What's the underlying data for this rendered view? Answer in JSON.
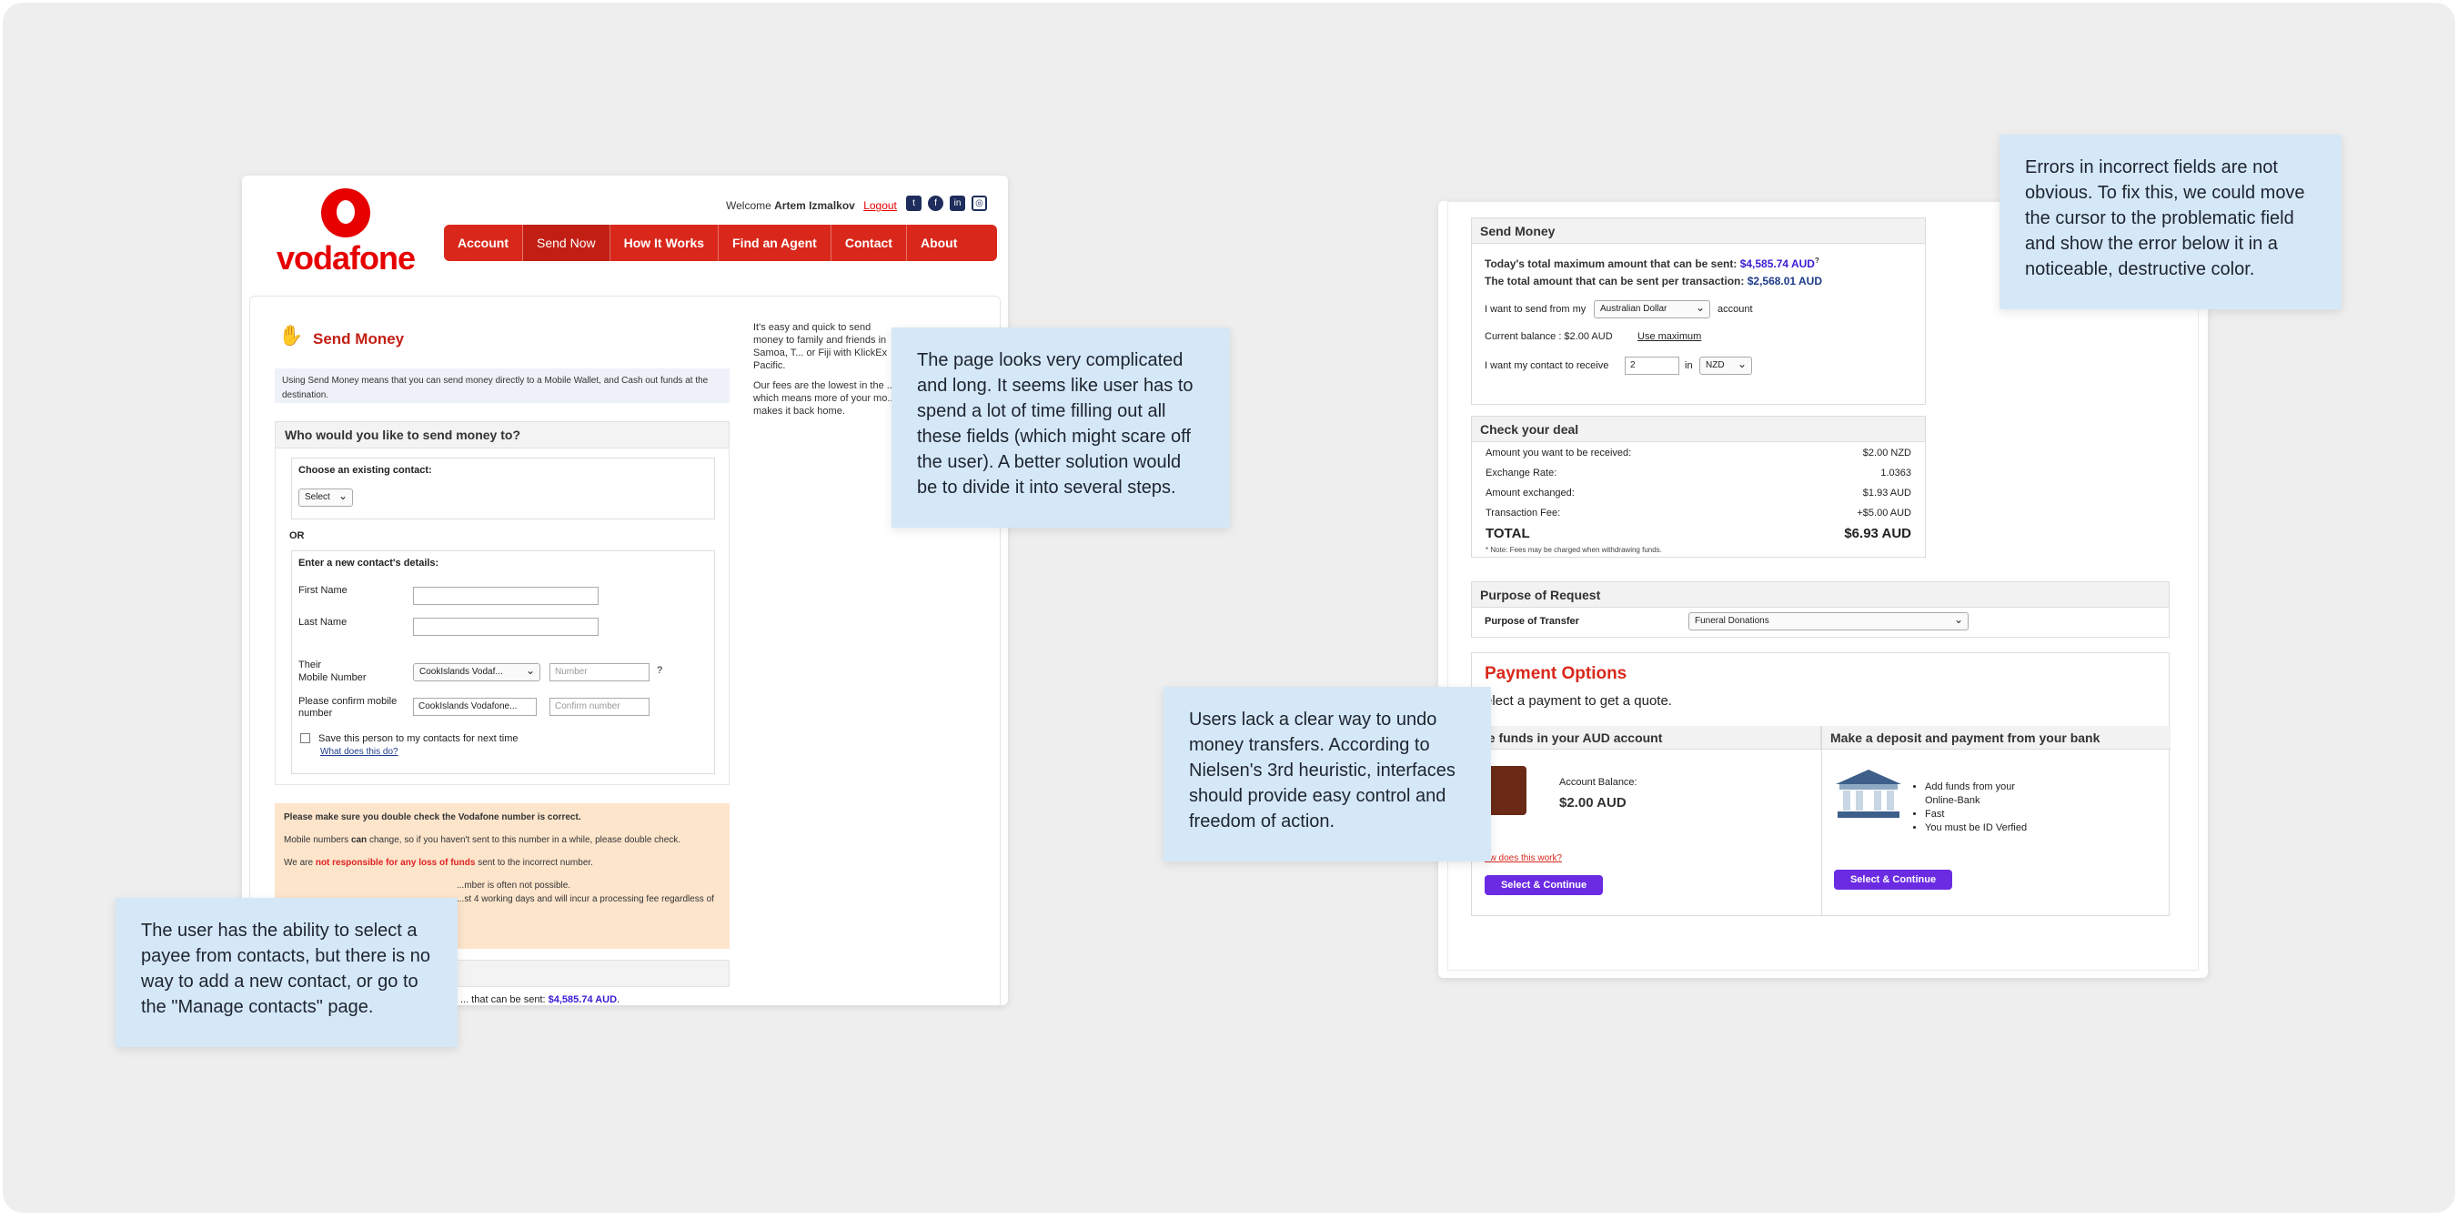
{
  "left_screen": {
    "brand": "vodafone",
    "welcome_prefix": "Welcome",
    "user_name": "Artem Izmalkov",
    "logout": "Logout",
    "social": [
      "twitter-icon",
      "facebook-icon",
      "linkedin-icon",
      "instagram-icon"
    ],
    "nav": [
      "Account",
      "Send Now",
      "How It Works",
      "Find an Agent",
      "Contact",
      "About"
    ],
    "title": "Send Money",
    "intro": "Using Send Money means that you can send money directly to a Mobile Wallet, and Cash out funds at the destination.",
    "side_text_1": "It's easy and quick to send money to family and friends in Samoa, T... or Fiji with KlickEx Pacific.",
    "side_text_2": "Our fees are the lowest in the ... which means more of your mo... makes it back home.",
    "section_title": "Who would you like to send money to?",
    "choose_existing": "Choose an existing contact:",
    "select": "Select",
    "or": "OR",
    "new_contact": "Enter a new contact's details:",
    "first_name": "First Name",
    "last_name": "Last Name",
    "their": "Their",
    "mobile_number": "Mobile Number",
    "country_value": "CookIslands Vodaf...",
    "number_placeholder": "Number",
    "question": "?",
    "confirm_label": "Please confirm mobile number",
    "confirm_country": "CookIslands Vodafone...",
    "confirm_placeholder": "Confirm number",
    "save_contact": "Save this person to my contacts for next time",
    "what_does": "What does this do?",
    "warn_title": "Please make sure you double check the Vodafone number is correct.",
    "warn_1a": "Mobile numbers",
    "warn_1b": "can",
    "warn_1c": "change, so if you haven't sent to this number in a while, please double check.",
    "warn_2a": "We are",
    "warn_2b": "not responsible for any loss of funds",
    "warn_2c": "sent to the incorrect number.",
    "warn_3": "...mber is often not possible.",
    "warn_4": "...st 4 working days and will incur a processing fee regardless of",
    "frag_text": "... that can be sent:",
    "frag_amount": "$4,585.74 AUD",
    "frag_tail": "."
  },
  "right_screen": {
    "send_title": "Send Money",
    "max_total_label": "Today's total maximum amount that can be sent:",
    "max_total_value": "$4,585.74 AUD",
    "max_total_sup": "?",
    "max_tx_label": "The total amount that can be sent per transaction:",
    "max_tx_value": "$2,568.01 AUD",
    "send_from_a": "I want to send from my",
    "currency_from": "Australian Dollar",
    "send_from_b": "account",
    "balance_label": "Current balance : $2.00 AUD",
    "use_max": "Use maximum",
    "receive_a": "I want my contact to receive",
    "receive_value": "2",
    "receive_in": "in",
    "currency_to": "NZD",
    "deal_title": "Check your deal",
    "deal_rows": [
      {
        "label": "Amount you want to be received:",
        "value": "$2.00 NZD"
      },
      {
        "label": "Exchange Rate:",
        "value": "1.0363"
      },
      {
        "label": "Amount exchanged:",
        "value": "$1.93 AUD"
      },
      {
        "label": "Transaction Fee:",
        "value": "+$5.00 AUD"
      }
    ],
    "total_label": "TOTAL",
    "total_value": "$6.93 AUD",
    "fee_note": "* Note: Fees may be charged when withdrawing funds.",
    "purpose_title": "Purpose of Request",
    "purpose_label": "Purpose of Transfer",
    "purpose_value": "Funeral Donations",
    "po_title": "Payment Options",
    "po_sub": "elect a payment to get a quote.",
    "col1_title": "se funds in your AUD account",
    "col2_title": "Make a deposit and payment from your bank",
    "acct_balance_label": "Account Balance:",
    "acct_balance_value": "$2.00 AUD",
    "how_link": "ow does this work?",
    "bank_bullets": [
      "Add funds from your Online-Bank",
      "Fast",
      "You must be ID Verfied"
    ],
    "select_continue": "Select & Continue"
  },
  "notes": {
    "complex": "The page looks very complicated and long. It seems like user has to spend a lot of time filling out all these fields (which might scare off the user). A better solution would be to divide it into several steps.",
    "contacts": "The user has the ability to select a payee from contacts, but there is no way to add a new contact, or go to the \"Manage contacts\" page.",
    "undo": "Users lack a clear way to undo money transfers. According to Nielsen's 3rd heuristic, interfaces should provide easy control and freedom of action.",
    "errors": "Errors in incorrect fields are not obvious. To fix this, we could move the cursor to the problematic field and show the error below it in a noticeable, destructive color."
  },
  "colors": {
    "background": "#eeeeee",
    "vodafone_red": "#e60000",
    "nav_red": "#d9281b",
    "note_blue": "#d5e8f7",
    "purple_button": "#6a2be2",
    "amount_blue": "#3a1cd6"
  }
}
